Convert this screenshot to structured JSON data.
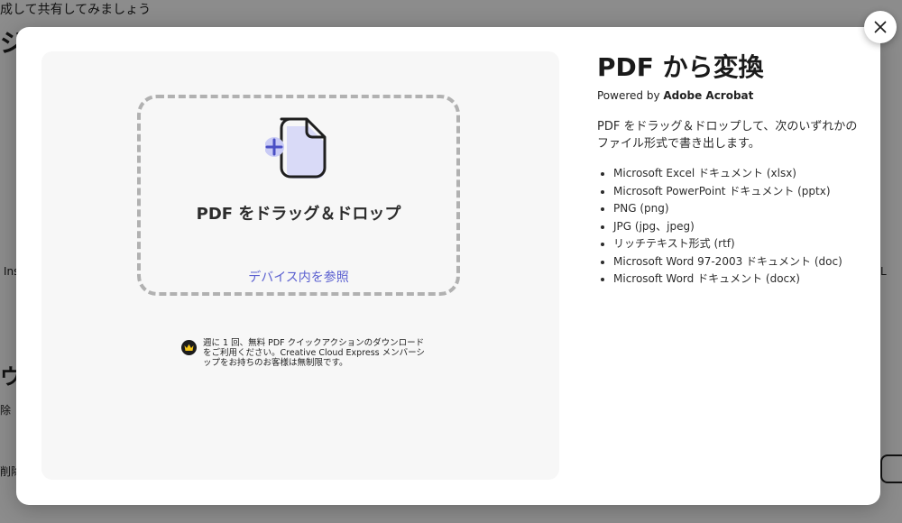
{
  "background": {
    "top_text": "成して共有してみましょう",
    "heading": "ジ",
    "left_text": "Ins",
    "right_text": "L",
    "heading2": "ウジ",
    "small_text_1": "除",
    "small_text_2": "削除"
  },
  "dropzone": {
    "title": "PDF をドラッグ＆ドロップ",
    "browse_link": "デバイス内を参照",
    "icon": "file-add-icon"
  },
  "notice": {
    "icon": "crown-icon",
    "text": "週に 1 回、無料 PDF クイックアクションのダウンロードをご利用ください。Creative Cloud Express メンバーシップをお持ちのお客様は無制限です。"
  },
  "info": {
    "title": "PDF から変換",
    "powered_prefix": "Powered by ",
    "powered_brand": "Adobe Acrobat",
    "description": "PDF をドラッグ＆ドロップして、次のいずれかのファイル形式で書き出します。",
    "formats": [
      "Microsoft Excel ドキュメント (xlsx)",
      "Microsoft PowerPoint ドキュメント (pptx)",
      "PNG (png)",
      "JPG (jpg、jpeg)",
      "リッチテキスト形式 (rtf)",
      "Microsoft Word 97-2003 ドキュメント (doc)",
      "Microsoft Word ドキュメント (docx)"
    ]
  },
  "close_button": {
    "icon": "close-icon"
  },
  "colors": {
    "accent": "#5a5fd0",
    "icon_tint": "#c9cbf5",
    "panel_bg": "#f7f7f7",
    "dash": "#b1b1b1"
  }
}
